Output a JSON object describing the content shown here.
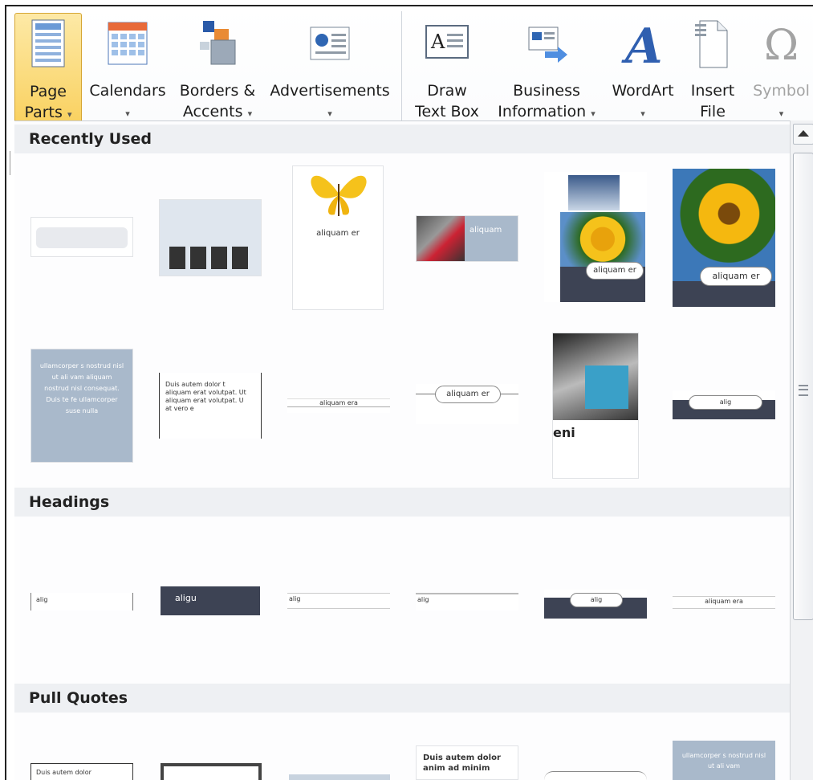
{
  "ribbon": {
    "page_parts": {
      "line1": "Page",
      "line2": "Parts",
      "caret": "▾"
    },
    "calendars": {
      "line1": "Calendars",
      "caret": "▾"
    },
    "borders": {
      "line1": "Borders &",
      "line2": "Accents",
      "caret": "▾"
    },
    "advertisements": {
      "line1": "Advertisements",
      "caret": "▾"
    },
    "draw_text_box": {
      "line1": "Draw",
      "line2": "Text Box"
    },
    "business_info": {
      "line1": "Business",
      "line2": "Information",
      "caret": "▾"
    },
    "wordart": {
      "line1": "WordArt",
      "caret": "▾"
    },
    "insert_file": {
      "line1": "Insert",
      "line2": "File"
    },
    "symbol": {
      "line1": "Symbol",
      "caret": "▾"
    }
  },
  "sections": {
    "recent": "Recently Used",
    "headings": "Headings",
    "pull_quotes": "Pull Quotes"
  },
  "samples": {
    "aliquam_er": "aliquam er",
    "aliquam_era": "aliquam era",
    "aliquam": "aliquam",
    "alig": "alig",
    "aligu": "aligu",
    "eni": "eni",
    "duis_autem": "Duis autem dolor",
    "duis_block": "Duis autem dolor t aliquam erat volutpat. Ut aliquam erat volutpat. U at vero e",
    "duis_anim": "Duis autem dolor anim ad minim",
    "ullamcorper": "ullamcorper s nostrud nisl ut ali vam aliquam nostrud nisl consequat. Duis te fe ullamcorper suse nulla",
    "ullam_short": "ullamcorper s nostrud nisl ut ali vam"
  },
  "colors": {
    "accent": "#f9d160",
    "panel_header": "#eef0f3",
    "blue_tile": "#a9b9cb",
    "dark_tile": "#3d4354"
  }
}
